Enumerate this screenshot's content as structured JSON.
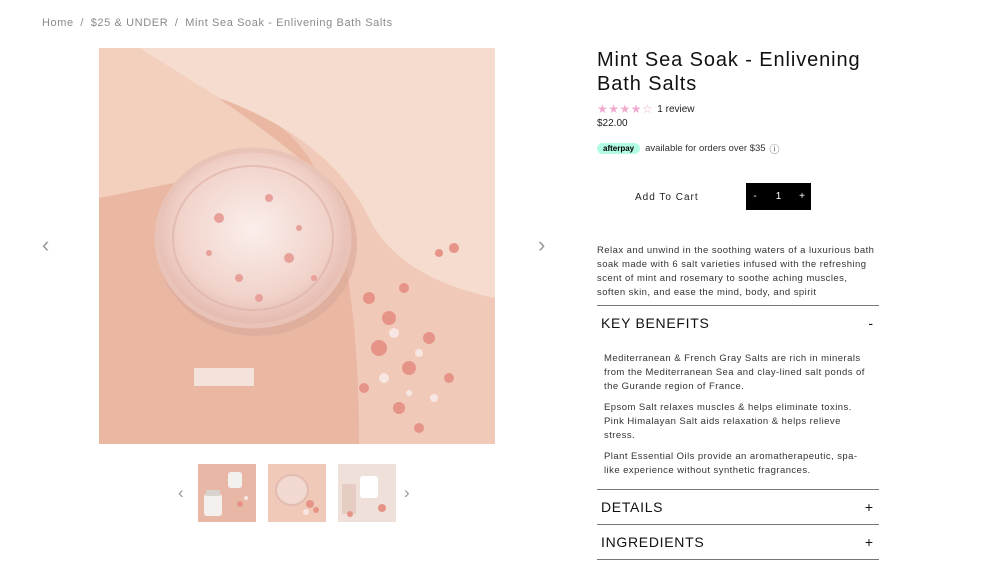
{
  "breadcrumb": {
    "items": [
      "Home",
      "$25 & UNDER",
      "Mint Sea Soak - Enlivening Bath Salts"
    ],
    "separator": "/"
  },
  "gallery": {
    "prev_arrow": "‹",
    "next_arrow": "›",
    "thumbnail_count": 3
  },
  "product": {
    "title": "Mint Sea Soak - Enlivening Bath Salts",
    "rating_stars": "★★★★☆",
    "rating": 4,
    "rating_max": 5,
    "review_count": "1 review",
    "price": "$22.00",
    "afterpay": {
      "badge": "afterpay",
      "text": "available for orders over $35",
      "info_icon": "ⓘ"
    },
    "add_to_cart": "Add To Cart",
    "quantity": {
      "minus": "-",
      "value": "1",
      "plus": "+"
    },
    "description": "Relax and unwind in the soothing waters of a luxurious bath soak made with 6 salt varieties infused with the refreshing scent of mint and rosemary to soothe aching muscles, soften skin, and ease the mind, body, and spirit"
  },
  "accordions": {
    "key_benefits": {
      "title": "KEY BENEFITS",
      "toggle": "-",
      "paragraphs": [
        "Mediterranean & French Gray Salts are rich in minerals from the Mediterranean Sea and clay-lined salt ponds of the Gurande region of France.",
        "Epsom Salt relaxes muscles & helps eliminate toxins. Pink Himalayan Salt aids relaxation & helps relieve stress.",
        "Plant Essential Oils provide an aromatherapeutic, spa-like experience without synthetic fragrances."
      ]
    },
    "details": {
      "title": "DETAILS",
      "toggle": "+"
    },
    "ingredients": {
      "title": "INGREDIENTS",
      "toggle": "+"
    }
  },
  "colors": {
    "star": "#f2a9cf",
    "afterpay_badge": "#b2fce4",
    "quantity_bg": "#000000",
    "image_background": "#efc6b3"
  }
}
